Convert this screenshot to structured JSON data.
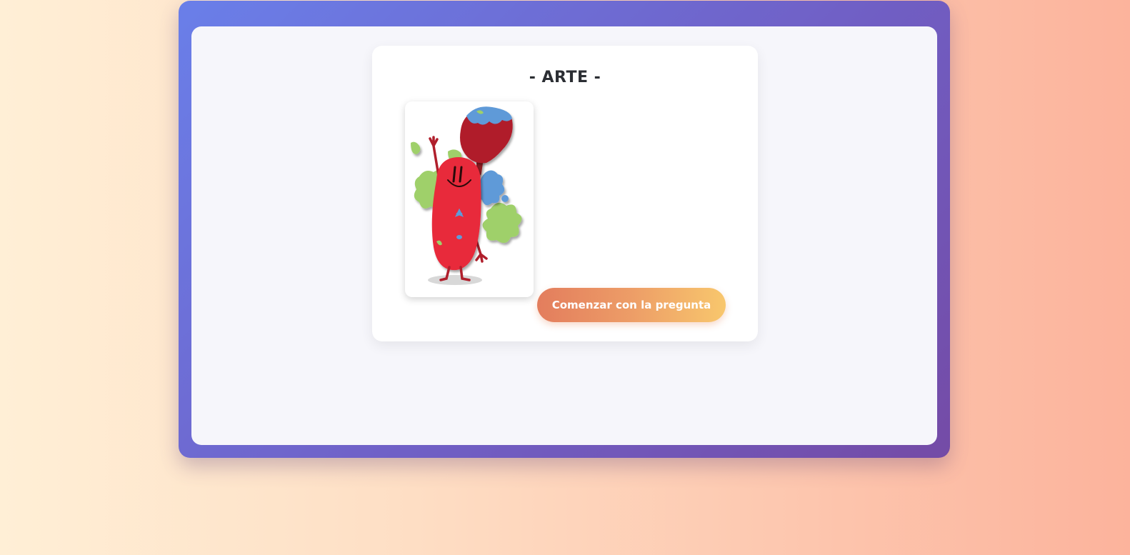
{
  "card": {
    "title": "- ARTE -",
    "category_image": "art-paintbrush-character",
    "start_button_label": "Comenzar con la pregunta"
  },
  "colors": {
    "frame_gradient_start": "#6a7fe9",
    "frame_gradient_end": "#744ba6",
    "button_gradient_start": "#e37d5d",
    "button_gradient_end": "#f8c76d",
    "character_red": "#e8293a"
  }
}
